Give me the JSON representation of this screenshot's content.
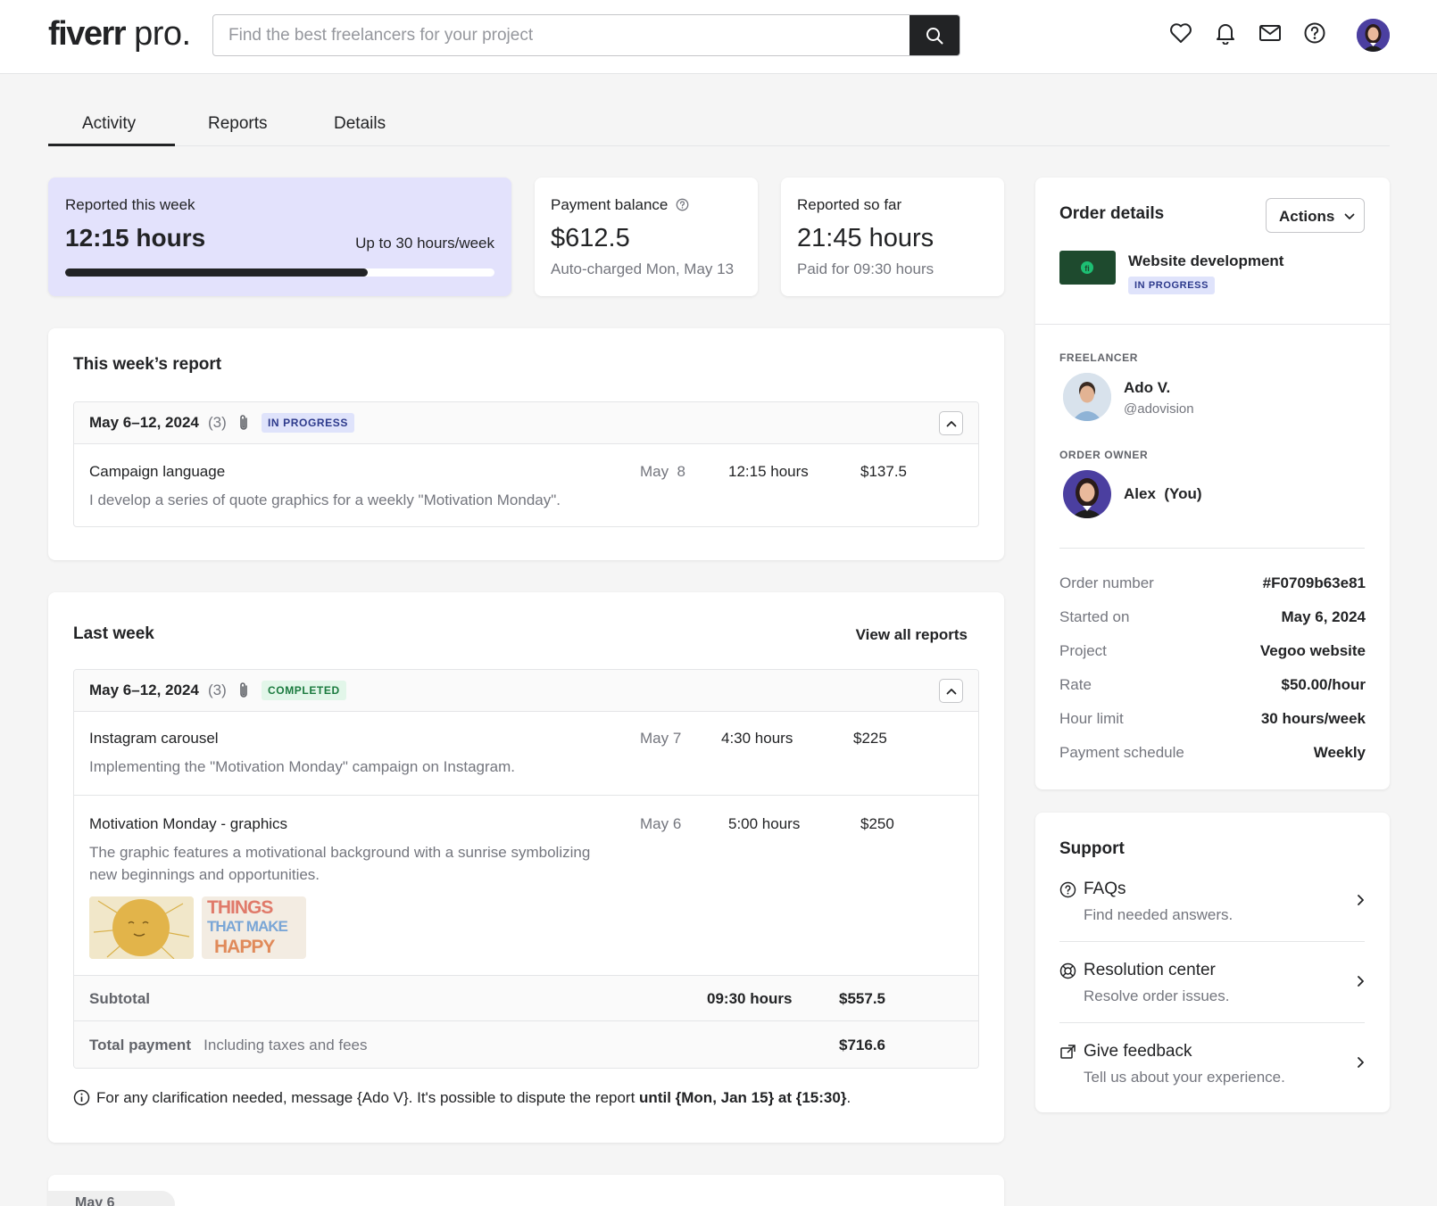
{
  "header": {
    "logo_main": "fiverr",
    "logo_pro": " pro.",
    "search_placeholder": "Find the best freelancers for your project"
  },
  "tabs": [
    {
      "label": "Activity",
      "active": true
    },
    {
      "label": "Reports",
      "active": false
    },
    {
      "label": "Details",
      "active": false
    }
  ],
  "stats": {
    "week": {
      "label": "Reported this week",
      "value": "12:15 hours",
      "limit": "Up to 30 hours/week",
      "progress": 0.705
    },
    "balance": {
      "label": "Payment balance",
      "value": "$612.5",
      "sub": "Auto-charged Mon, May 13"
    },
    "sofar": {
      "label": "Reported so far",
      "value": "21:45 hours",
      "sub": "Paid for 09:30 hours"
    }
  },
  "this_week": {
    "title": "This week’s report",
    "date": "May 6–12, 2024",
    "count": "(3)",
    "badge": "IN PROGRESS",
    "rows": [
      {
        "title": "Campaign language",
        "desc": "I develop a series of quote graphics for a weekly \"Motivation Monday\".",
        "date": "May  8",
        "hours": "12:15 hours",
        "amount": "$137.5"
      }
    ]
  },
  "last_week": {
    "title": "Last week",
    "view_all": "View all reports",
    "date": "May 6–12, 2024",
    "count": "(3)",
    "badge": "COMPLETED",
    "rows": [
      {
        "title": "Instagram carousel",
        "desc": "Implementing the \"Motivation Monday\" campaign on Instagram.",
        "date": "May 7",
        "hours": "4:30 hours",
        "amount": "$225"
      },
      {
        "title": "Motivation Monday - graphics",
        "desc1": "The graphic features a motivational background with a sunrise symbolizing",
        "desc2": "new beginnings and opportunities.",
        "date": "May 6",
        "hours": "5:00 hours",
        "amount": "$250"
      }
    ],
    "thumb_text": [
      "THINGS",
      "THAT MAKE",
      "HAPPY"
    ],
    "subtotal_label": "Subtotal",
    "subtotal_hours": "09:30 hours",
    "subtotal_amount": "$557.5",
    "total_label": "Total payment",
    "total_note": "Including taxes and fees",
    "total_amount": "$716.6",
    "note_prefix": "For any clarification needed, message {Ado V}. It's possible to dispute the report ",
    "note_bold": "until {Mon, Jan 15} at {15:30}",
    "note_suffix": "."
  },
  "next_section": {
    "date_chip": "May 6"
  },
  "order": {
    "title": "Order details",
    "actions_label": "Actions",
    "project_name": "Website development",
    "project_badge": "IN PROGRESS",
    "freelancer_label": "FREELANCER",
    "freelancer_name": "Ado V.",
    "freelancer_handle": "@adovision",
    "owner_label": "ORDER OWNER",
    "owner_name": "Alex  (You)",
    "fields": [
      {
        "label": "Order number",
        "value": "#F0709b63e81"
      },
      {
        "label": "Started on",
        "value": "May 6, 2024"
      },
      {
        "label": "Project",
        "value": "Vegoo website"
      },
      {
        "label": "Rate",
        "value": "$50.00/hour"
      },
      {
        "label": "Hour limit",
        "value": "30 hours/week"
      },
      {
        "label": "Payment schedule",
        "value": "Weekly"
      }
    ]
  },
  "support": {
    "title": "Support",
    "items": [
      {
        "title": "FAQs",
        "sub": "Find needed answers.",
        "icon": "question-circle-icon"
      },
      {
        "title": "Resolution center",
        "sub": "Resolve order issues.",
        "icon": "lifebuoy-icon"
      },
      {
        "title": "Give feedback",
        "sub": "Tell us about your experience.",
        "icon": "feedback-icon"
      }
    ]
  },
  "colors": {
    "accent_card": "#e3e2fc",
    "dark": "#222325",
    "thumb_green": "#1e4a2e"
  }
}
